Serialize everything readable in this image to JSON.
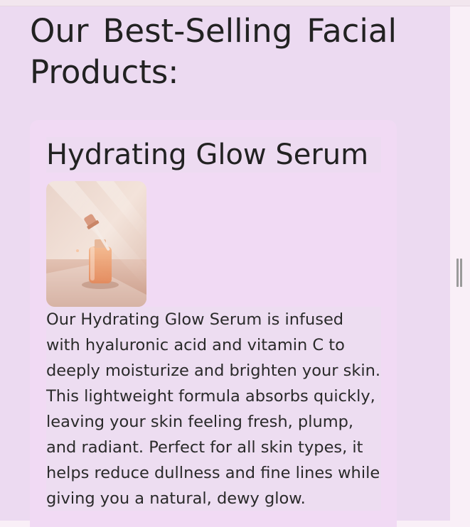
{
  "section": {
    "title": "Our Best-Selling Facial Products:"
  },
  "product": {
    "name": "Hydrating Glow Serum",
    "image_icon": "serum-bottle-photo",
    "description": "Our Hydrating Glow Serum is infused with hyaluronic acid and vitamin C to deeply moisturize and brighten your skin. This lightweight formula absorbs quickly, leaving your skin feeling fresh, plump, and radiant. Perfect for all skin types, it helps reduce dullness and fine lines while giving you a natural, dewy glow."
  },
  "colors": {
    "panel_bg": "#ecdaf1",
    "card_bg": "#f1daf4",
    "text": "#222222"
  }
}
